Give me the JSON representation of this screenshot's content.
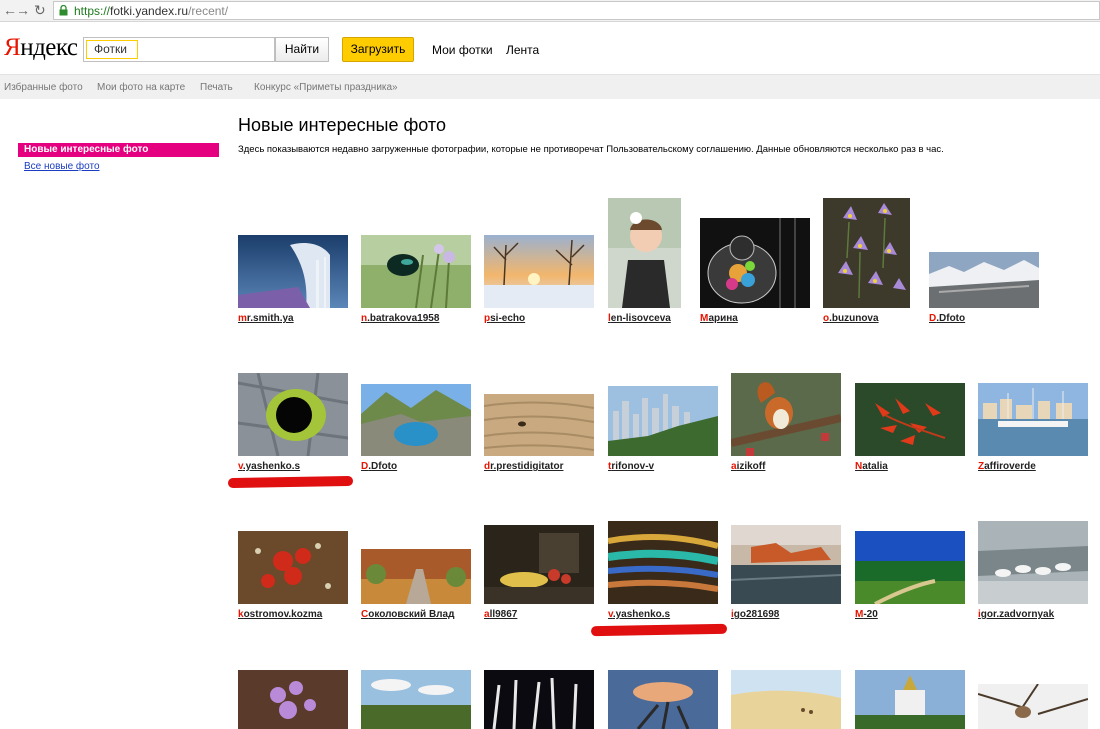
{
  "browser": {
    "back": "←",
    "forward": "→",
    "reload": "↻",
    "url_scheme": "https://",
    "url_host": "fotki.yandex.ru",
    "url_path": "/recent/"
  },
  "header": {
    "logo_first": "Я",
    "logo_rest": "ндекс",
    "search_tag": "Фотки",
    "search_value": "",
    "find_label": "Найти",
    "upload_label": "Загрузить",
    "my_photos": "Мои фотки",
    "feed": "Лента"
  },
  "subnav": {
    "favorites": "Избранные фото",
    "map": "Мои фото на карте",
    "print": "Печать",
    "contest": "Конкурс «Приметы праздника»"
  },
  "sidebar": {
    "active": "Новые интересные фото",
    "all_new": "Все новые фото"
  },
  "main": {
    "title": "Новые интересные фото",
    "description": "Здесь показываются недавно загруженные фотографии, которые не противоречат Пользовательскому соглашению. Данные обновляются несколько раз в час."
  },
  "photos": {
    "r1": [
      {
        "first": "m",
        "rest": "r.smith.ya"
      },
      {
        "first": "n",
        "rest": ".batrakova1958"
      },
      {
        "first": "p",
        "rest": "si-echo"
      },
      {
        "first": "l",
        "rest": "en-lisovceva"
      },
      {
        "first": "М",
        "rest": "арина"
      },
      {
        "first": "o",
        "rest": ".buzunova"
      },
      {
        "first": "D",
        "rest": ".Dfoto"
      }
    ],
    "r2": [
      {
        "first": "v",
        "rest": ".yashenko.s"
      },
      {
        "first": "D",
        "rest": ".Dfoto"
      },
      {
        "first": "d",
        "rest": "r.prestidigitator"
      },
      {
        "first": "t",
        "rest": "rifonov-v"
      },
      {
        "first": "a",
        "rest": "izikoff"
      },
      {
        "first": "N",
        "rest": "atalia"
      },
      {
        "first": "Z",
        "rest": "affiroverde"
      }
    ],
    "r3": [
      {
        "first": "k",
        "rest": "ostromov.kozma"
      },
      {
        "first": "С",
        "rest": "околовский Влад"
      },
      {
        "first": "a",
        "rest": "ll9867"
      },
      {
        "first": "v",
        "rest": ".yashenko.s"
      },
      {
        "first": "i",
        "rest": "go281698"
      },
      {
        "first": "M",
        "rest": "-20"
      },
      {
        "first": "i",
        "rest": "gor.zadvornyak"
      }
    ]
  },
  "colors": {
    "accent_pink": "#e4007f",
    "yandex_red": "#e61400",
    "upload_yellow": "#ffcc00",
    "link_blue": "#1a3dc1"
  }
}
